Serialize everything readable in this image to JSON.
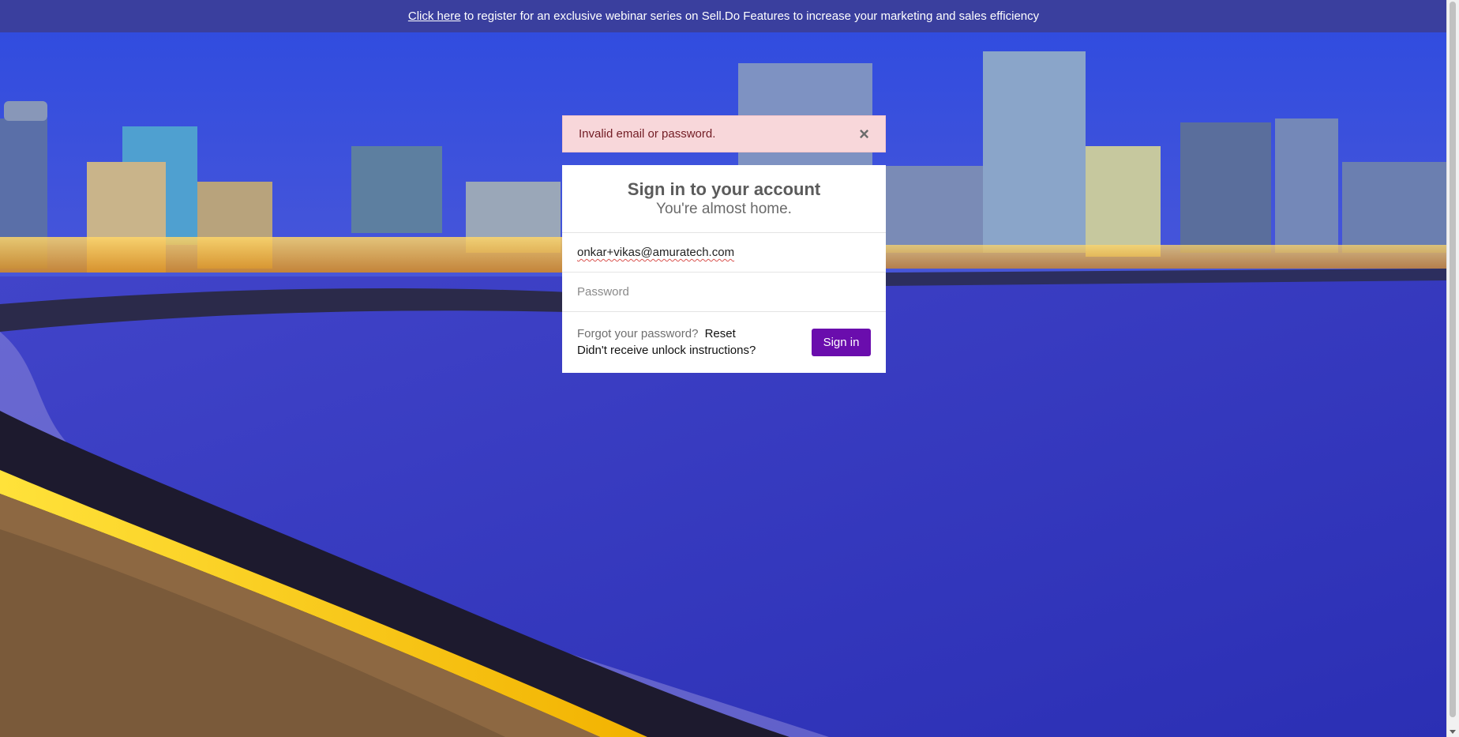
{
  "banner": {
    "link_text": "Click here",
    "text": "to register for an exclusive webinar series on Sell.Do Features to increase your marketing and sales efficiency"
  },
  "alert": {
    "message": "Invalid email or password.",
    "close_icon": "×"
  },
  "login": {
    "title": "Sign in to your account",
    "subtitle": "You're almost home.",
    "email_value": "onkar+vikas@amuratech.com",
    "password_placeholder": "Password",
    "forgot_text": "Forgot your password?",
    "reset_label": "Reset",
    "unlock_label": "Didn't receive unlock instructions?",
    "signin_label": "Sign in"
  },
  "colors": {
    "banner_bg": "#3a3f9e",
    "alert_bg": "#f8d7da",
    "alert_text": "#721c24",
    "signin_button": "#6a0dad"
  }
}
